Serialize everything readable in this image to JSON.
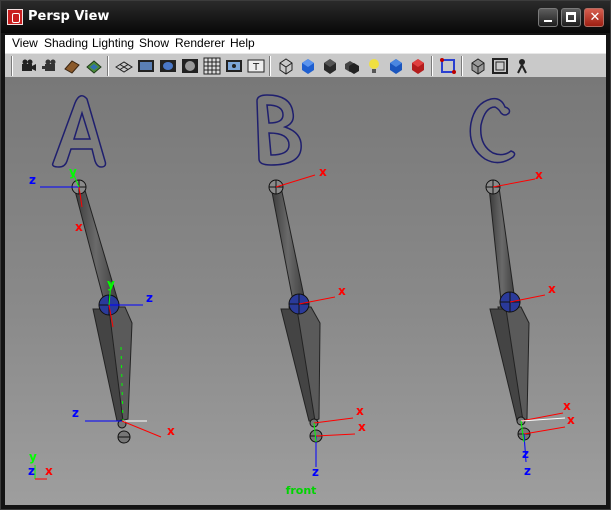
{
  "window": {
    "title": "Persp View"
  },
  "menu": [
    "View",
    "Shading",
    "Lighting",
    "Show",
    "Renderer",
    "Help"
  ],
  "toolbar": {
    "icons": [
      "camera-select-icon",
      "camera-attributes-icon",
      "bookmarks-icon",
      "image-plane-icon",
      "grid-icon",
      "film-gate-icon",
      "resolution-gate-icon",
      "gate-mask-icon",
      "field-chart-icon",
      "safe-action-icon",
      "safe-title-icon",
      "wireframe-icon",
      "smooth-shade-icon",
      "default-material-icon",
      "shade-all-icon",
      "use-all-lights-icon",
      "textured-icon",
      "shadows-icon",
      "isolate-select-icon",
      "xray-icon",
      "xray-joints-icon",
      "backface-icon"
    ]
  },
  "viewport": {
    "rigs": [
      "A",
      "B",
      "C"
    ],
    "axis_labels": {
      "x": "x",
      "y": "y",
      "z": "z"
    },
    "camera_label": "front"
  },
  "colors": {
    "axis_x": "#ff0000",
    "axis_y": "#00ff00",
    "axis_z": "#0000ff",
    "letters": "#1f1f6e",
    "camera": "#00d400"
  }
}
